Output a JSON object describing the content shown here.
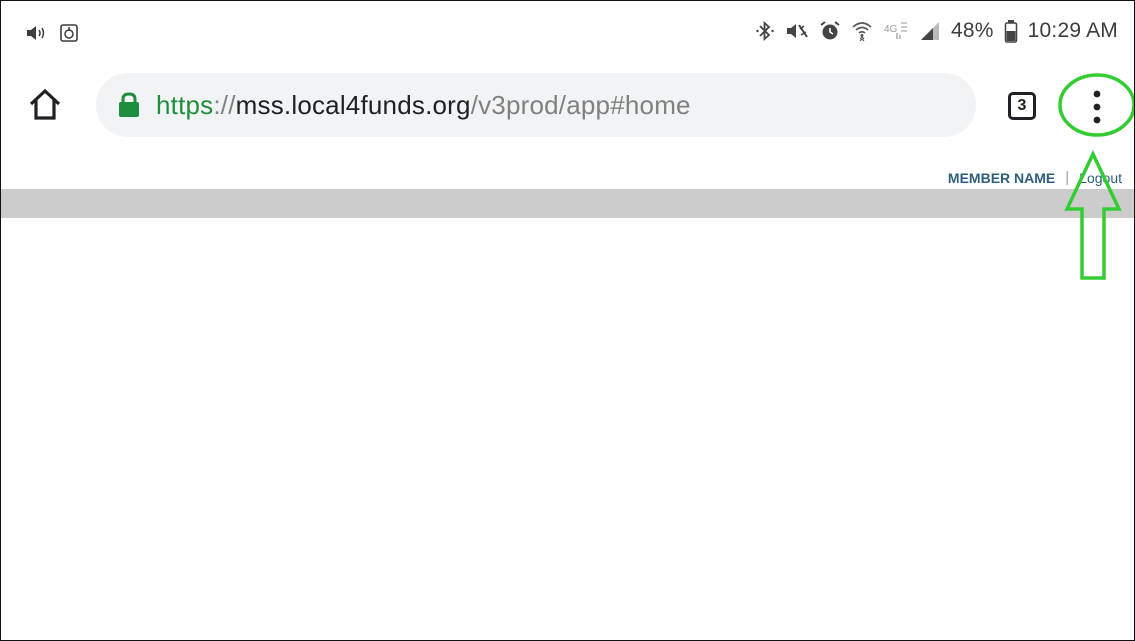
{
  "status_bar": {
    "left_icons": [
      "volume-icon",
      "screenshot-icon"
    ],
    "right_icons": [
      "bluetooth-icon",
      "mute-icon",
      "alarm-icon",
      "wifi-icon",
      "lte-icon",
      "signal-icon",
      "battery-icon"
    ],
    "lte_label": "4G",
    "battery_percent": "48%",
    "time": "10:29 AM"
  },
  "toolbar": {
    "url_scheme": "https",
    "url_separator": "://",
    "url_host": "mss.local4funds.org",
    "url_path": "/v3prod/app#home",
    "tab_count": "3"
  },
  "page": {
    "member_name": "MEMBER NAME",
    "separator": "|",
    "logout": "Logout"
  },
  "colors": {
    "annotation": "#33cc33",
    "url_scheme": "#1e8e3e",
    "link_text": "#2e5f7a",
    "gray_band": "#cccccc"
  }
}
